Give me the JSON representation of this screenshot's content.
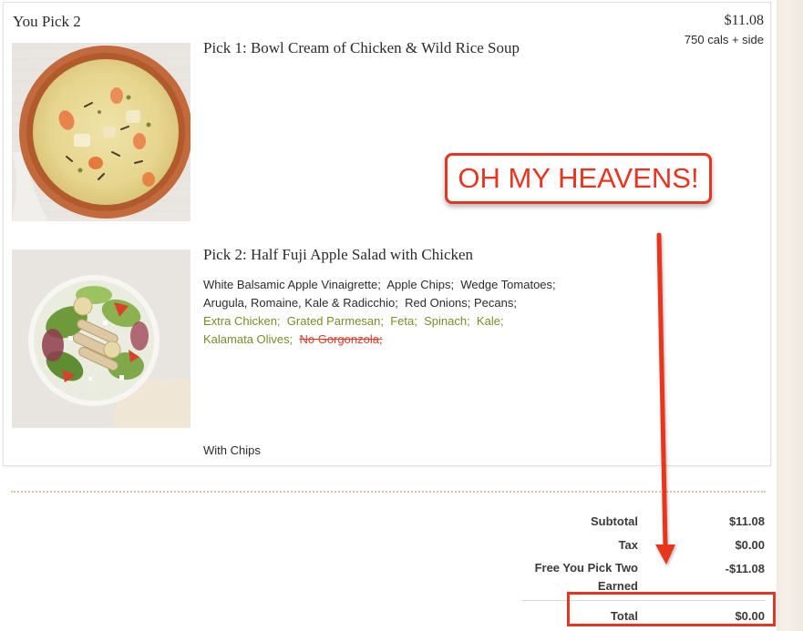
{
  "item": {
    "title": "You Pick 2",
    "price": "$11.08",
    "calories": "750 cals + side"
  },
  "pick1": {
    "title": "Pick 1: Bowl Cream of Chicken & Wild Rice Soup",
    "image_icon": "soup-bowl-photo"
  },
  "pick2": {
    "title": "Pick 2: Half Fuji Apple Salad with Chicken",
    "image_icon": "salad-bowl-photo",
    "modifiers_standard": [
      "White Balsamic Apple Vinaigrette;",
      "Apple Chips;",
      "Wedge Tomatoes;",
      "Arugula, Romaine, Kale & Radicchio;",
      "Red Onions;",
      "Pecans;"
    ],
    "modifiers_added": [
      "Extra Chicken;",
      "Grated Parmesan;",
      "Feta;",
      "Spinach;",
      "Kale;",
      "Kalamata Olives;"
    ],
    "modifiers_removed": [
      "No Gorgonzola;"
    ],
    "side": "With Chips"
  },
  "annotation": {
    "text": "OH MY HEAVENS!",
    "color": "#e8351f"
  },
  "summary": {
    "subtotal_label": "Subtotal",
    "subtotal_value": "$11.08",
    "tax_label": "Tax",
    "tax_value": "$0.00",
    "discount_label": "Free You Pick Two Earned",
    "discount_value": "-$11.08",
    "total_label": "Total",
    "total_value": "$0.00"
  },
  "colors": {
    "added_modifier": "#7a8b2a",
    "removed_modifier": "#e03b2a",
    "annotation_red": "#e8351f"
  }
}
